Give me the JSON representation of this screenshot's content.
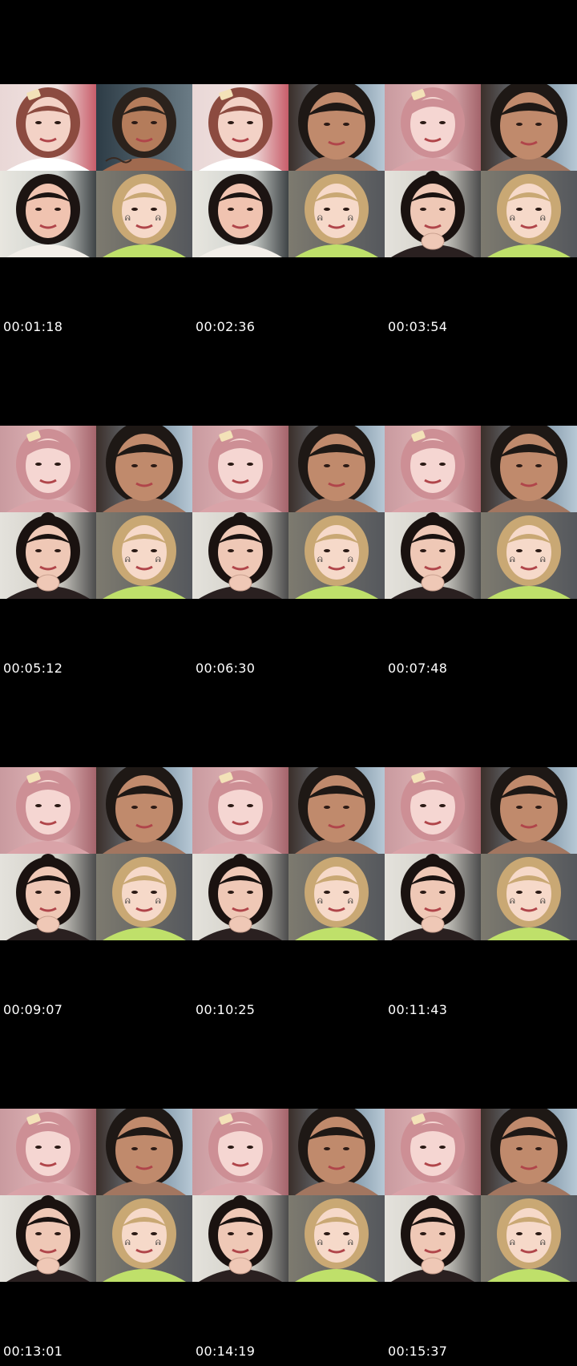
{
  "frames": [
    {
      "timestamp": "00:01:18",
      "tiles": [
        "girl-bob-hairclip",
        "man-tattoo",
        "girl-dark-hair",
        "girl-blonde-stickers"
      ]
    },
    {
      "timestamp": "00:02:36",
      "tiles": [
        "girl-bob-hairclip",
        "man-closeup",
        "girl-dark-hair",
        "girl-blonde-stickers"
      ]
    },
    {
      "timestamp": "00:03:54",
      "tiles": [
        "girl-pink-bangs",
        "man-closeup",
        "girl-bun-hands",
        "girl-blonde-stickers"
      ]
    },
    {
      "timestamp": "00:05:12",
      "tiles": [
        "girl-pink-bangs",
        "man-closeup",
        "girl-bun-hands",
        "girl-blonde-stickers"
      ]
    },
    {
      "timestamp": "00:06:30",
      "tiles": [
        "girl-pink-bangs",
        "man-closeup",
        "girl-bun-hands",
        "girl-blonde-stickers"
      ]
    },
    {
      "timestamp": "00:07:48",
      "tiles": [
        "girl-pink-bangs",
        "man-closeup",
        "girl-bun-hands",
        "girl-blonde-stickers"
      ]
    },
    {
      "timestamp": "00:09:07",
      "tiles": [
        "girl-pink-bangs",
        "man-closeup",
        "girl-bun-hands",
        "girl-blonde-stickers"
      ]
    },
    {
      "timestamp": "00:10:25",
      "tiles": [
        "girl-pink-bangs",
        "man-closeup",
        "girl-bun-hands",
        "girl-blonde-stickers"
      ]
    },
    {
      "timestamp": "00:11:43",
      "tiles": [
        "girl-pink-bangs",
        "man-closeup",
        "girl-bun-hands",
        "girl-blonde-stickers"
      ]
    },
    {
      "timestamp": "00:13:01",
      "tiles": [
        "girl-pink-bangs",
        "man-closeup",
        "girl-bun-hands",
        "girl-blonde-stickers"
      ]
    },
    {
      "timestamp": "00:14:19",
      "tiles": [
        "girl-pink-bangs",
        "man-closeup",
        "girl-bun-hands",
        "girl-blonde-stickers"
      ]
    },
    {
      "timestamp": "00:15:37",
      "tiles": [
        "girl-pink-bangs",
        "man-closeup",
        "girl-bun-hands",
        "girl-blonde-stickers"
      ]
    }
  ],
  "colors": {
    "background": "#000000",
    "timestamp_text": "#ffffff"
  }
}
